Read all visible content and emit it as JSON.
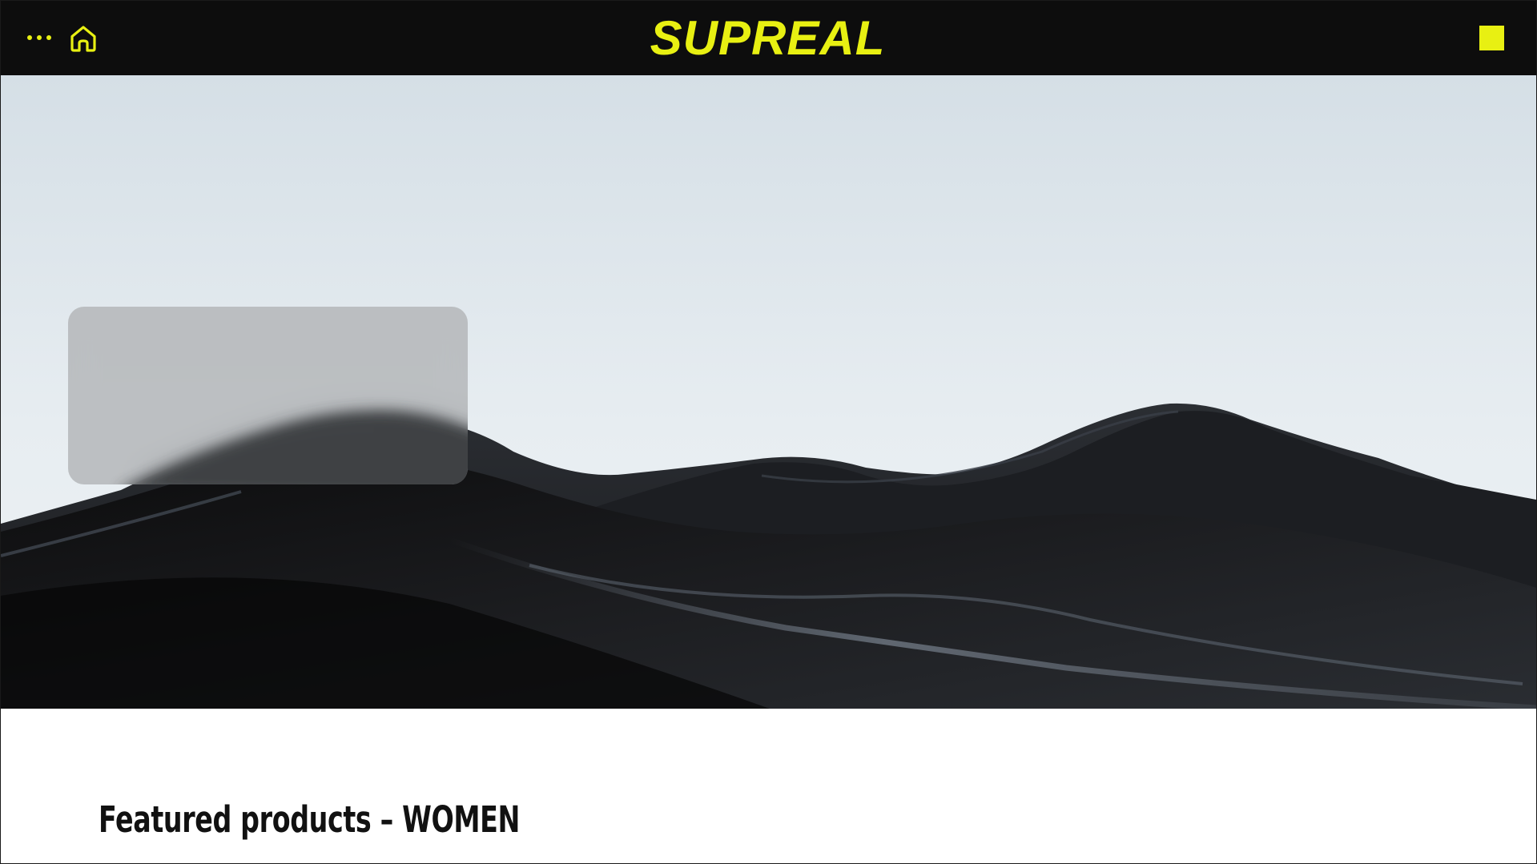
{
  "brand": {
    "name": "SUPREAL",
    "accent_color": "#e8f012",
    "header_background": "#0d0d0d"
  },
  "header": {
    "menu_icon": "more-horizontal-icon",
    "home_icon": "home-icon",
    "cart_icon": "square-icon"
  },
  "hero": {
    "image": "dark-sand-dunes-under-pale-sky",
    "overlay_card": "frosted-glass-panel"
  },
  "featured": {
    "title": "Featured products – WOMEN"
  }
}
